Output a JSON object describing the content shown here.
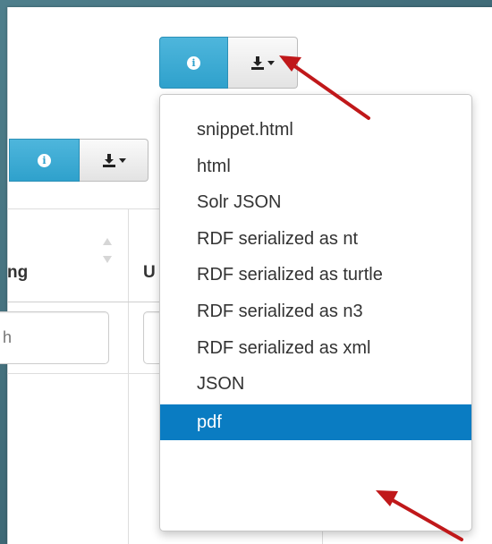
{
  "toolbar_top": {
    "info_glyph": "i",
    "download_icon": "download-icon"
  },
  "toolbar_secondary": {
    "info_glyph": "i",
    "download_icon": "download-icon"
  },
  "table": {
    "columns": [
      {
        "header": "ng"
      },
      {
        "header": "U"
      }
    ],
    "filter_inputs": [
      {
        "placeholder": "h"
      },
      {
        "placeholder": ""
      }
    ]
  },
  "dropdown": {
    "items": [
      {
        "label": "snippet.html"
      },
      {
        "label": "html"
      },
      {
        "label": "Solr JSON"
      },
      {
        "label": "RDF serialized as nt"
      },
      {
        "label": "RDF serialized as turtle"
      },
      {
        "label": "RDF serialized as n3"
      },
      {
        "label": "RDF serialized as xml"
      },
      {
        "label": "JSON"
      },
      {
        "label": "pdf"
      }
    ],
    "active_index": 8
  },
  "colors": {
    "info_button": "#2fa1cc",
    "menu_active": "#0a7cc2",
    "annotation_arrow": "#c0181a"
  }
}
